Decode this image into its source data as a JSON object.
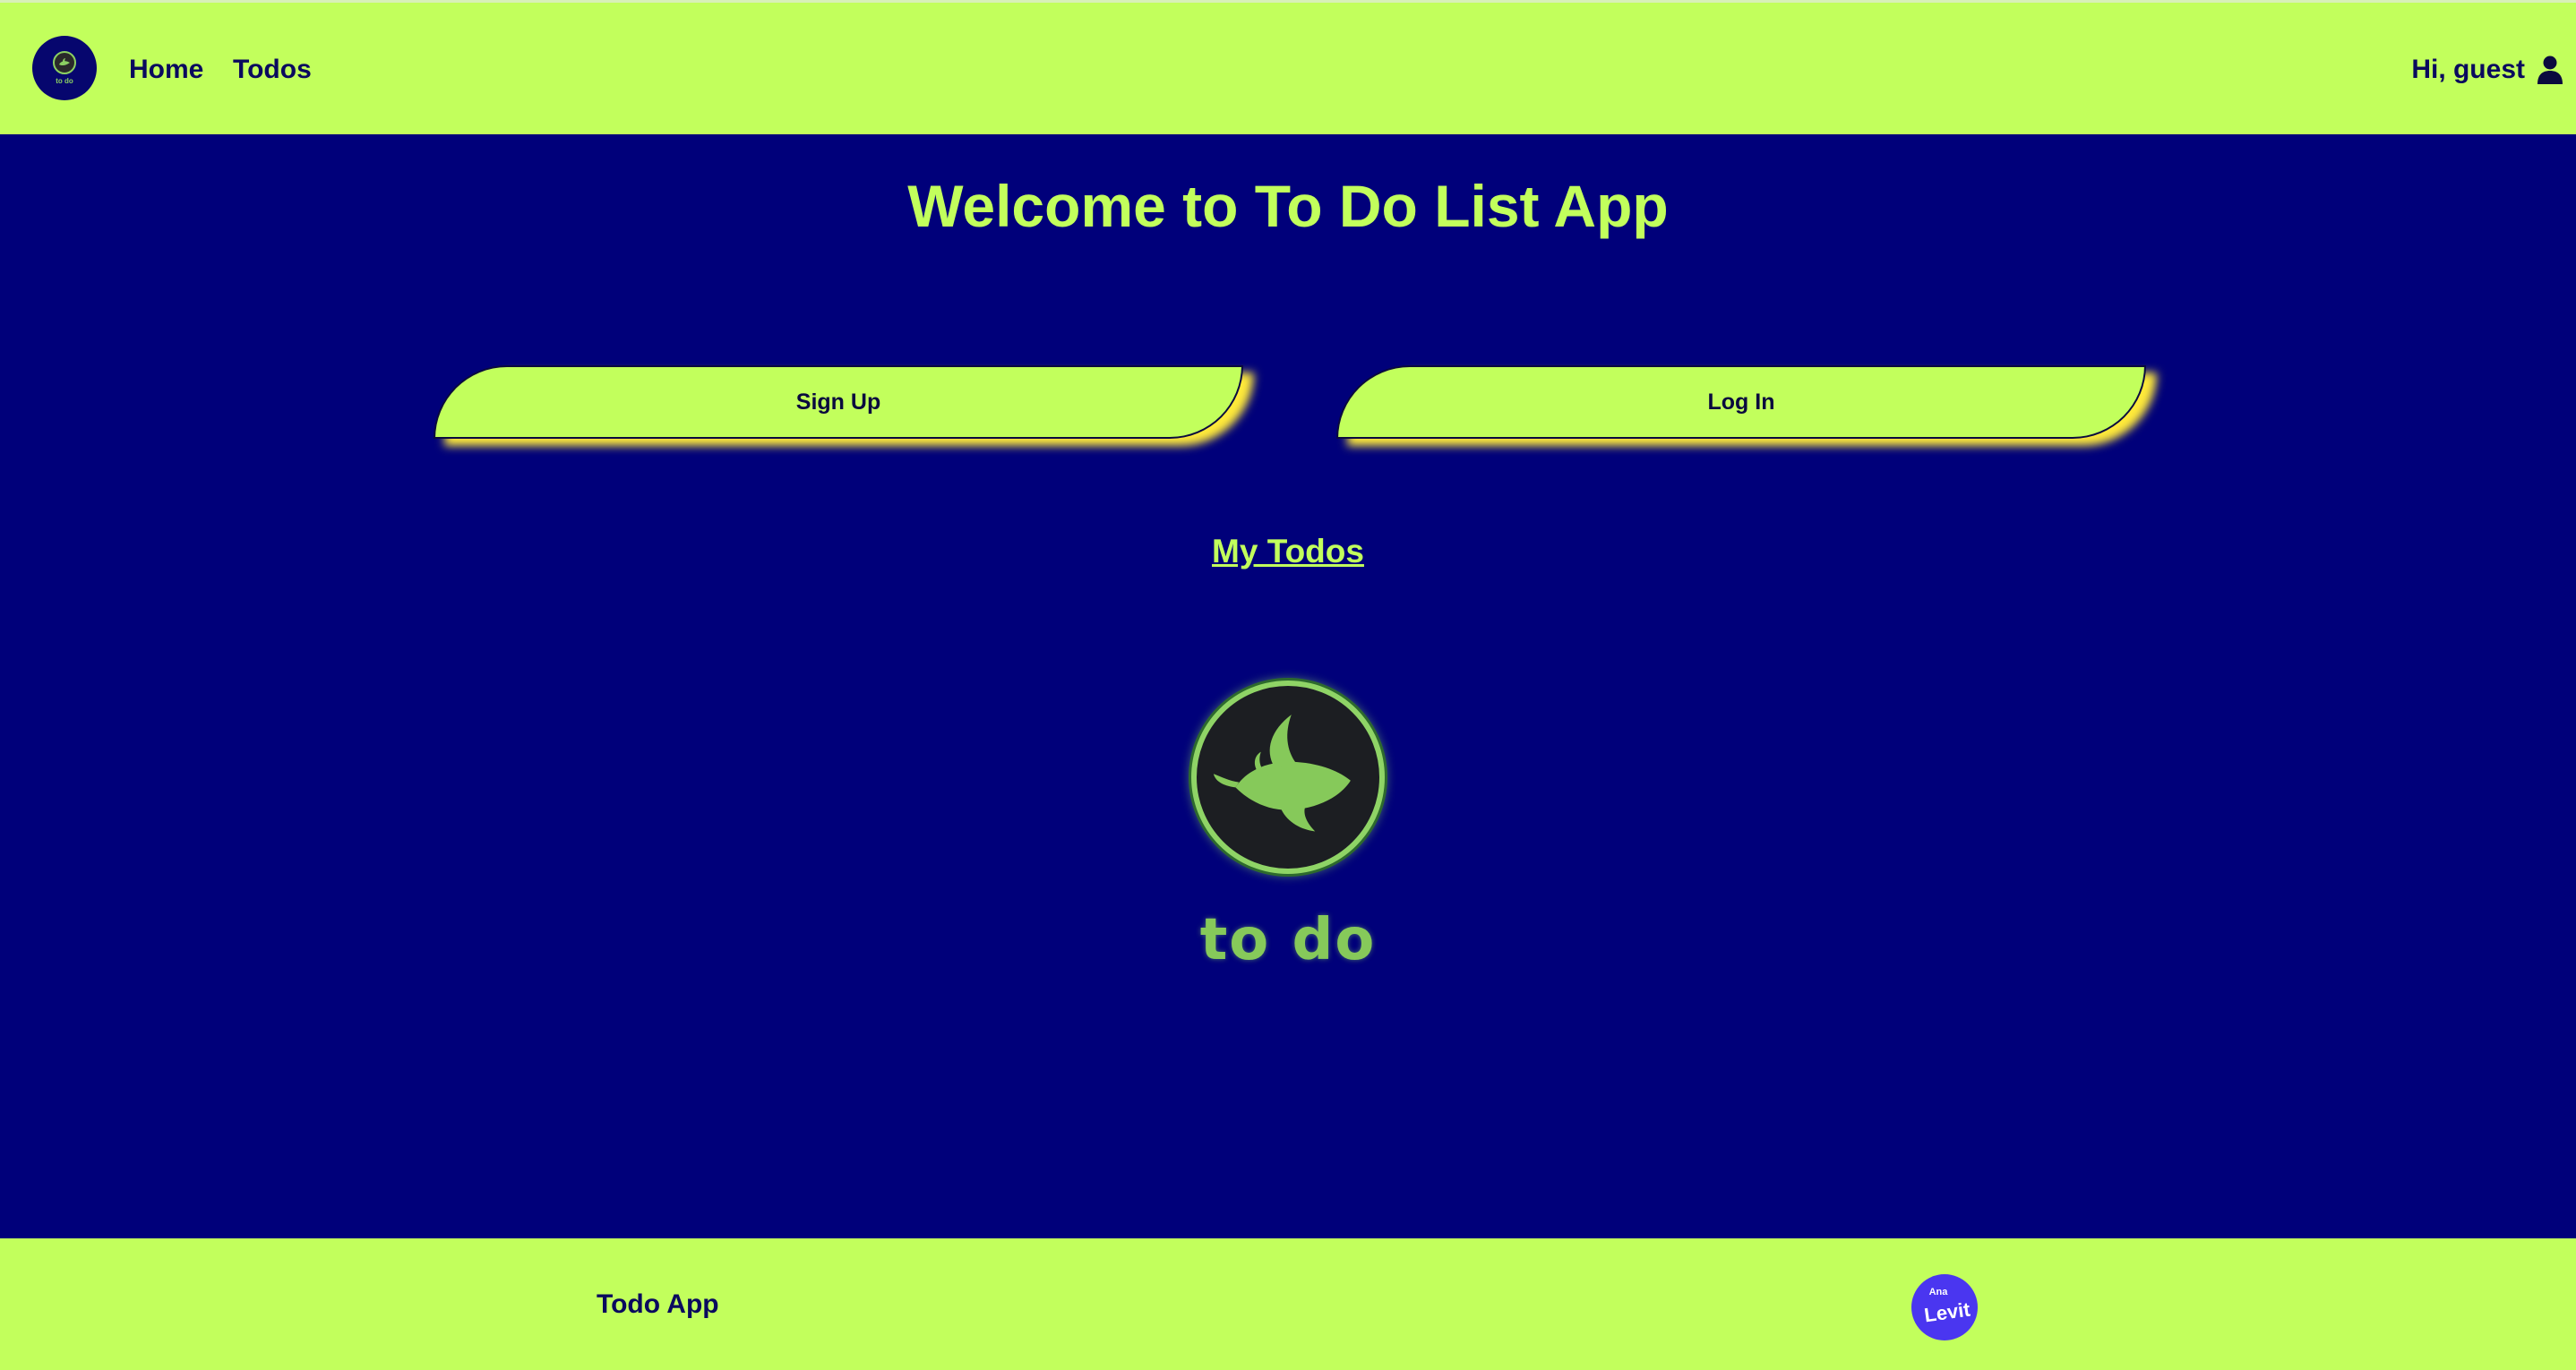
{
  "header": {
    "logo_label": "to do",
    "nav": [
      {
        "label": "Home"
      },
      {
        "label": "Todos"
      }
    ],
    "greeting": "Hi, guest",
    "user_icon": "user-icon"
  },
  "main": {
    "title": "Welcome to To Do List App",
    "signup_label": "Sign Up",
    "login_label": "Log In",
    "my_todos_link": "My Todos",
    "logo_text": "to do"
  },
  "footer": {
    "title": "Todo App",
    "badge_top": "Ana",
    "badge_bottom": "Levit"
  },
  "colors": {
    "accent": "#c2ff5c",
    "background": "#00007a",
    "text_dark": "#0a0a5e",
    "shadow": "#ffea3a",
    "logo_green": "#86c95a",
    "badge": "#4a36f0"
  }
}
